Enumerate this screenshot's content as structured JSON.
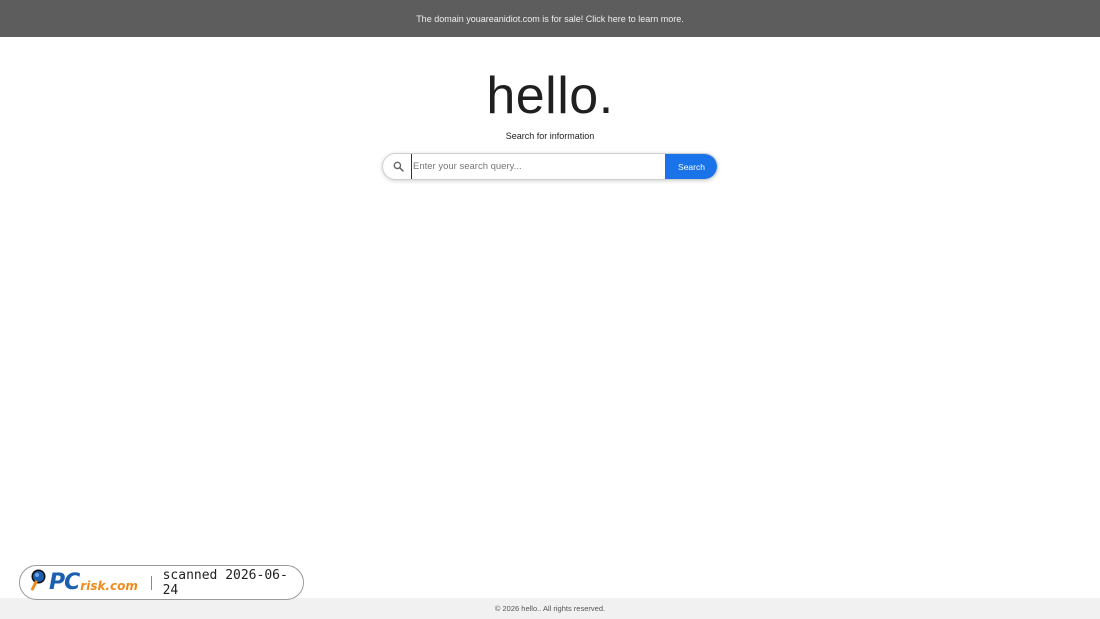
{
  "topbar": {
    "sale_notice": "The domain youareanidiot.com is for sale! Click here to learn more."
  },
  "hero": {
    "title": "hello.",
    "subtitle": "Search for information"
  },
  "search": {
    "placeholder": "Enter your search query...",
    "value": "",
    "button_label": "Search",
    "icon": "search-icon",
    "accent_color": "#1a73e8"
  },
  "badge": {
    "logo_pc": "PC",
    "logo_risk": "risk.com",
    "scanned_text": "scanned 2026-06-24",
    "logo_icon": "magnifier-icon"
  },
  "footer": {
    "copyright": "© 2026 hello.. All rights reserved."
  }
}
